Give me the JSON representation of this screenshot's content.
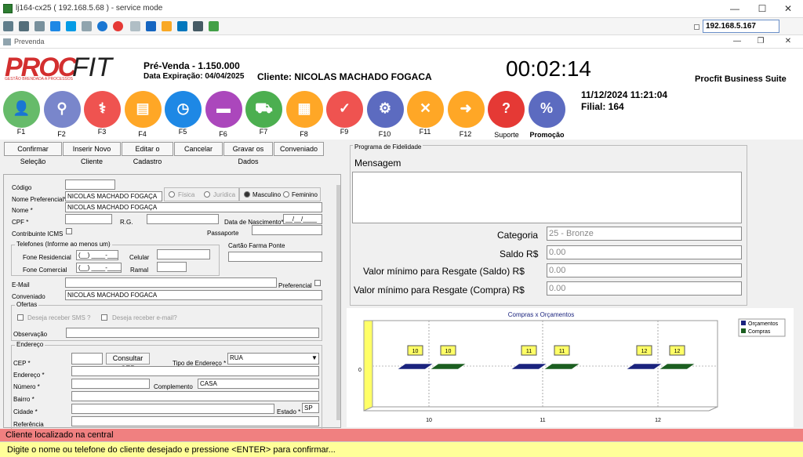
{
  "window": {
    "title": "lj164-cx25 ( 192.168.5.68 ) - service mode",
    "sub_title": "Prevenda",
    "ip": "192.168.5.167"
  },
  "header": {
    "logo_a": "PROC",
    "logo_b": "FIT",
    "logo_tag": "GESTÃO BRENDADA A PROCESSOS",
    "prevenda": "Pré-Venda - 1.150.000",
    "expiracao": "Data Expiração: 04/04/2025",
    "cliente": "Cliente: NICOLAS MACHADO FOGACA",
    "timer": "00:02:14",
    "suite": "Procfit Business Suite",
    "datetime": "11/12/2024 11:21:04",
    "filial": "Filial: 164"
  },
  "fkeys": [
    {
      "label": "F1",
      "icon": "users-icon",
      "color": "#66bb6a"
    },
    {
      "label": "F2",
      "icon": "search-icon",
      "color": "#7986cb"
    },
    {
      "label": "F3",
      "icon": "medical-icon",
      "color": "#ef5350"
    },
    {
      "label": "F4",
      "icon": "id-card-icon",
      "color": "#ffa726"
    },
    {
      "label": "F5",
      "icon": "clock-icon",
      "color": "#1e88e5"
    },
    {
      "label": "F6",
      "icon": "truck-icon",
      "color": "#ab47bc"
    },
    {
      "label": "F7",
      "icon": "cart-icon",
      "color": "#4caf50"
    },
    {
      "label": "F8",
      "icon": "card-icon",
      "color": "#ffa726"
    },
    {
      "label": "F9",
      "icon": "check-icon",
      "color": "#ef5350"
    },
    {
      "label": "F10",
      "icon": "gears-icon",
      "color": "#5c6bc0"
    },
    {
      "label": "F11",
      "icon": "cancel-icon",
      "color": "#ffa726"
    },
    {
      "label": "F12",
      "icon": "arrow-icon",
      "color": "#ffa726"
    },
    {
      "label": "Suporte",
      "icon": "help-icon",
      "color": "#e53935"
    },
    {
      "label": "Promoção",
      "icon": "discount-icon",
      "color": "#5c6bc0"
    }
  ],
  "buttons": {
    "confirmar": "Confirmar Seleção",
    "inserir": "Inserir Novo Cliente",
    "editar": "Editar o Cadastro",
    "cancelar": "Cancelar",
    "gravar": "Gravar os Dados",
    "conveniado": "Conveniado"
  },
  "form": {
    "codigo_label": "Código",
    "codigo": "",
    "nome_pref_label": "Nome Preferencial*",
    "nome_pref": "NICOLAS MACHADO FOGAÇA",
    "nome_label": "Nome *",
    "nome": "NICOLAS MACHADO FOGAÇA",
    "fisica": "Física",
    "juridica": "Jurídica",
    "masculino": "Masculino",
    "feminino": "Feminino",
    "cpf_label": "CPF *",
    "rg_label": "R.G.",
    "nasc_label": "Data de Nascimento*",
    "nasc": "__/__/____",
    "icms_label": "Contribuinte ICMS",
    "passaporte_label": "Passaporte",
    "telefones_group": "Telefones (Informe ao menos um)",
    "fone_res_label": "Fone Residencial",
    "fone_res": "(__) ____-____",
    "celular_label": "Celular",
    "fone_com_label": "Fone Comercial",
    "fone_com": "(__) ____-____",
    "ramal_label": "Ramal",
    "cartao_label": "Cartão Farma Ponte",
    "email_label": "E-Mail",
    "preferencial_label": "Preferencial",
    "conveniado_label": "Conveniado",
    "conveniado": "NICOLAS MACHADO FOGACA",
    "ofertas_group": "Ofertas",
    "sms_label": "Deseja receber SMS ?",
    "email_of_label": "Deseja receber e-mail?",
    "obs_label": "Observação",
    "endereco_group": "Endereço",
    "cep_label": "CEP *",
    "cep": "",
    "consultar_cep": "Consultar CEP",
    "tipo_end_label": "Tipo de Endereço *",
    "tipo_end": "RUA",
    "endereco_label": "Endereço *",
    "numero_label": "Número *",
    "complemento_label": "Complemento",
    "complemento": "CASA",
    "bairro_label": "Bairro *",
    "cidade_label": "Cidade *",
    "estado_label": "Estado *",
    "estado": "SP",
    "referencia_label": "Referência"
  },
  "fidelidade": {
    "group": "Programa de Fidelidade",
    "mensagem_label": "Mensagem",
    "categoria_label": "Categoria",
    "categoria": "25 - Bronze",
    "saldo_label": "Saldo R$",
    "saldo": "0.00",
    "min_saldo_label": "Valor mínimo para Resgate (Saldo) R$",
    "min_saldo": "0.00",
    "min_compra_label": "Valor mínimo para Resgate (Compra) R$",
    "min_compra": "0.00"
  },
  "chart_data": {
    "type": "bar",
    "title": "Compras x Orçamentos",
    "categories": [
      "10",
      "11",
      "12"
    ],
    "series": [
      {
        "name": "Orçamentos",
        "values": [
          0,
          0,
          0
        ],
        "color": "#1a237e"
      },
      {
        "name": "Compras",
        "values": [
          0,
          0,
          0
        ],
        "color": "#1b5e20"
      }
    ],
    "y_tick": "0",
    "data_labels": [
      "10",
      "10",
      "11",
      "11",
      "12",
      "12"
    ],
    "legend": "top-right"
  },
  "status": {
    "line1": "Cliente localizado na central",
    "line2": "Digite o nome ou telefone do cliente desejado e pressione <ENTER> para confirmar..."
  }
}
